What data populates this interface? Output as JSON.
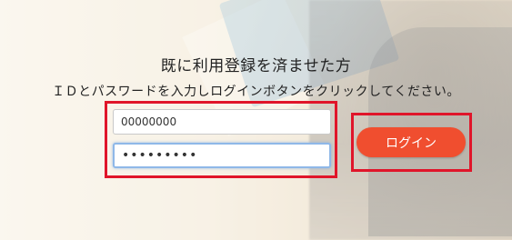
{
  "login_section": {
    "heading": "既に利用登録を済ませた方",
    "instruction": "ＩＤとパスワードを入力しログインボタンをクリックしてください。",
    "id_field": {
      "value": "00000000"
    },
    "password_field": {
      "value": "•••••••••"
    },
    "login_button_label": "ログイン"
  },
  "highlight_color": "#e0152a",
  "button_color": "#f04e2f"
}
